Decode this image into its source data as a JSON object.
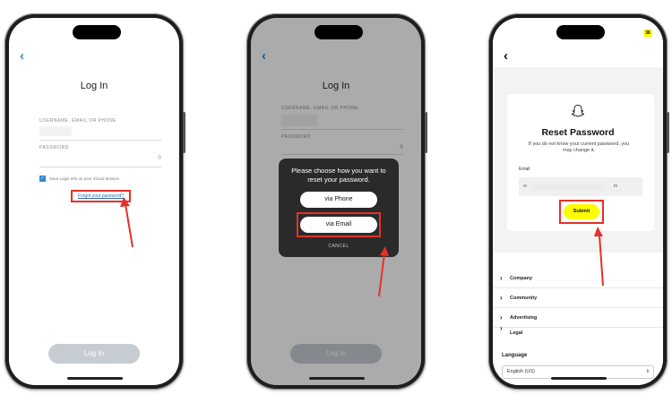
{
  "login_screen": {
    "title": "Log In",
    "username_label": "USERNAME, EMAIL OR PHONE",
    "password_label": "PASSWORD",
    "save_login_label": "Save Login Info on your iCloud devices",
    "forgot_link": "Forgot your password?",
    "login_button": "Log In",
    "back_icon": "‹",
    "eye_icon": "⦸"
  },
  "reset_dialog": {
    "title": "Please choose how you want to reset your password.",
    "via_phone": "via Phone",
    "via_email": "via Email",
    "cancel": "CANCEL"
  },
  "reset_screen": {
    "badge": "36",
    "title": "Reset Password",
    "subtitle": "If you do not know your current password, you may change it.",
    "email_label": "Email",
    "email_value_start": "vi",
    "email_value_end": "m",
    "submit_button": "Submit",
    "footer_items": [
      "Company",
      "Community",
      "Advertising",
      "Legal"
    ],
    "language_label": "Language",
    "language_value": "English (US)"
  },
  "colors": {
    "highlight": "#e53127",
    "snap_yellow": "#fffc00",
    "link_blue": "#2d6fb3"
  }
}
